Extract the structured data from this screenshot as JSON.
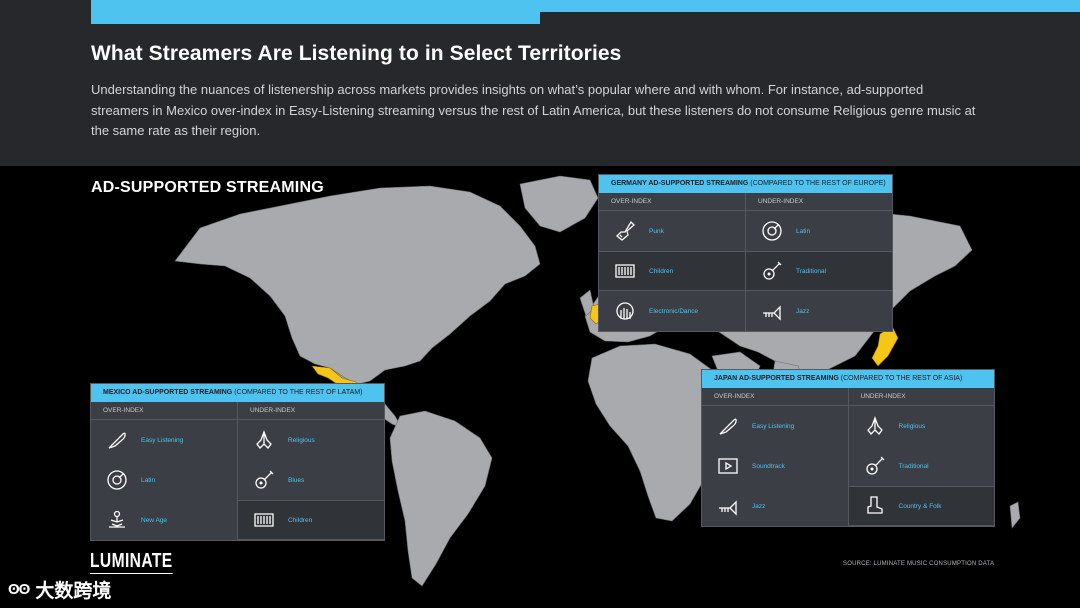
{
  "header": {
    "title": "What Streamers Are Listening to in Select Territories",
    "intro": "Understanding the nuances of listenership across markets provides insights on what’s popular where and with whom. For instance, ad-supported streamers in Mexico over-index in Easy-Listening streaming versus the rest of Latin America, but these listeners do not consume Religious genre music at the same rate as their region."
  },
  "section_label": "AD-SUPPORTED STREAMING",
  "colors": {
    "accent": "#4fc3f0",
    "highlight": "#f5c518",
    "land": "#a9aaae",
    "panel": "#3b3e44",
    "background": "#000000"
  },
  "panels": {
    "germany": {
      "title": "GERMANY AD-SUPPORTED STREAMING",
      "subtitle": "(COMPARED TO THE REST OF EUROPE)",
      "over_head": "OVER-INDEX",
      "under_head": "UNDER-INDEX",
      "over": [
        {
          "label": "Punk",
          "icon": "electric-guitar-icon"
        },
        {
          "label": "Children",
          "icon": "xylophone-icon"
        },
        {
          "label": "Electronic/Dance",
          "icon": "hand-disc-icon"
        }
      ],
      "under": [
        {
          "label": "Latin",
          "icon": "maracas-disc-icon"
        },
        {
          "label": "Traditional",
          "icon": "acoustic-guitar-icon"
        },
        {
          "label": "Jazz",
          "icon": "trumpet-icon"
        }
      ]
    },
    "mexico": {
      "title": "MEXICO AD-SUPPORTED STREAMING",
      "subtitle": "(COMPARED TO THE REST OF LATAM)",
      "over_head": "OVER-INDEX",
      "under_head": "UNDER-INDEX",
      "over": [
        {
          "label": "Easy Listening",
          "icon": "feather-icon"
        },
        {
          "label": "Latin",
          "icon": "maracas-disc-icon"
        },
        {
          "label": "New Age",
          "icon": "meditation-icon"
        }
      ],
      "under": [
        {
          "label": "Religious",
          "icon": "praying-hands-icon"
        },
        {
          "label": "Blues",
          "icon": "acoustic-guitar-icon"
        },
        {
          "label": "Children",
          "icon": "xylophone-icon"
        }
      ]
    },
    "japan": {
      "title": "JAPAN AD-SUPPORTED STREAMING",
      "subtitle": "(COMPARED TO THE REST OF ASIA)",
      "over_head": "OVER-INDEX",
      "under_head": "UNDER-INDEX",
      "over": [
        {
          "label": "Easy Listening",
          "icon": "feather-icon"
        },
        {
          "label": "Soundtrack",
          "icon": "film-play-icon"
        },
        {
          "label": "Jazz",
          "icon": "trumpet-icon"
        }
      ],
      "under": [
        {
          "label": "Religious",
          "icon": "praying-hands-icon"
        },
        {
          "label": "Traditional",
          "icon": "acoustic-guitar-icon"
        },
        {
          "label": "Country & Folk",
          "icon": "cowboy-boot-icon"
        }
      ]
    }
  },
  "footer": {
    "logo": "LUMINATE",
    "source": "SOURCE: LUMINATE MUSIC CONSUMPTION DATA",
    "watermark": "大数跨境"
  }
}
